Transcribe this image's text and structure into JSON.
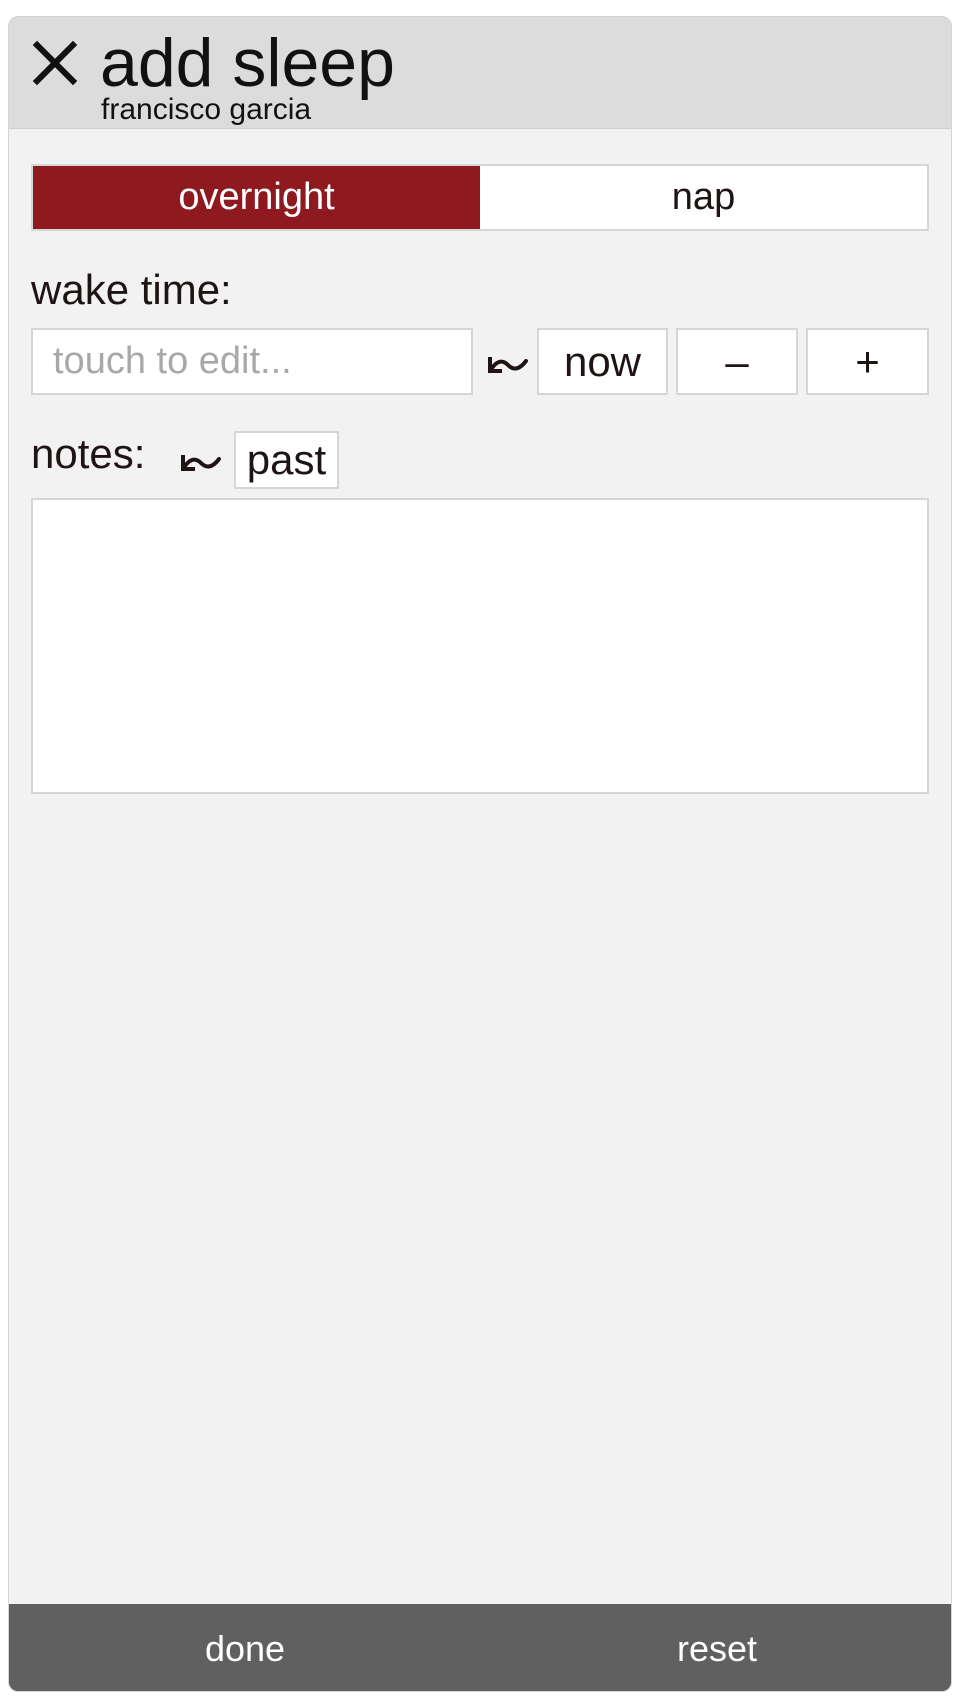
{
  "header": {
    "title": "add sleep",
    "subtitle": "francisco garcia",
    "close_icon": "close-icon"
  },
  "sleep_type": {
    "options": [
      "overnight",
      "nap"
    ],
    "selected": "overnight",
    "active_color": "#8e1a1f"
  },
  "wake_time": {
    "label": "wake time:",
    "input_value": "",
    "placeholder": "touch to edit...",
    "approx_icon": "tilde-wave-icon",
    "now_label": "now",
    "minus_label": "–",
    "plus_label": "+"
  },
  "notes": {
    "label": "notes:",
    "approx_icon": "tilde-wave-icon",
    "past_label": "past",
    "value": ""
  },
  "footer": {
    "done_label": "done",
    "reset_label": "reset",
    "background": "#606060"
  }
}
